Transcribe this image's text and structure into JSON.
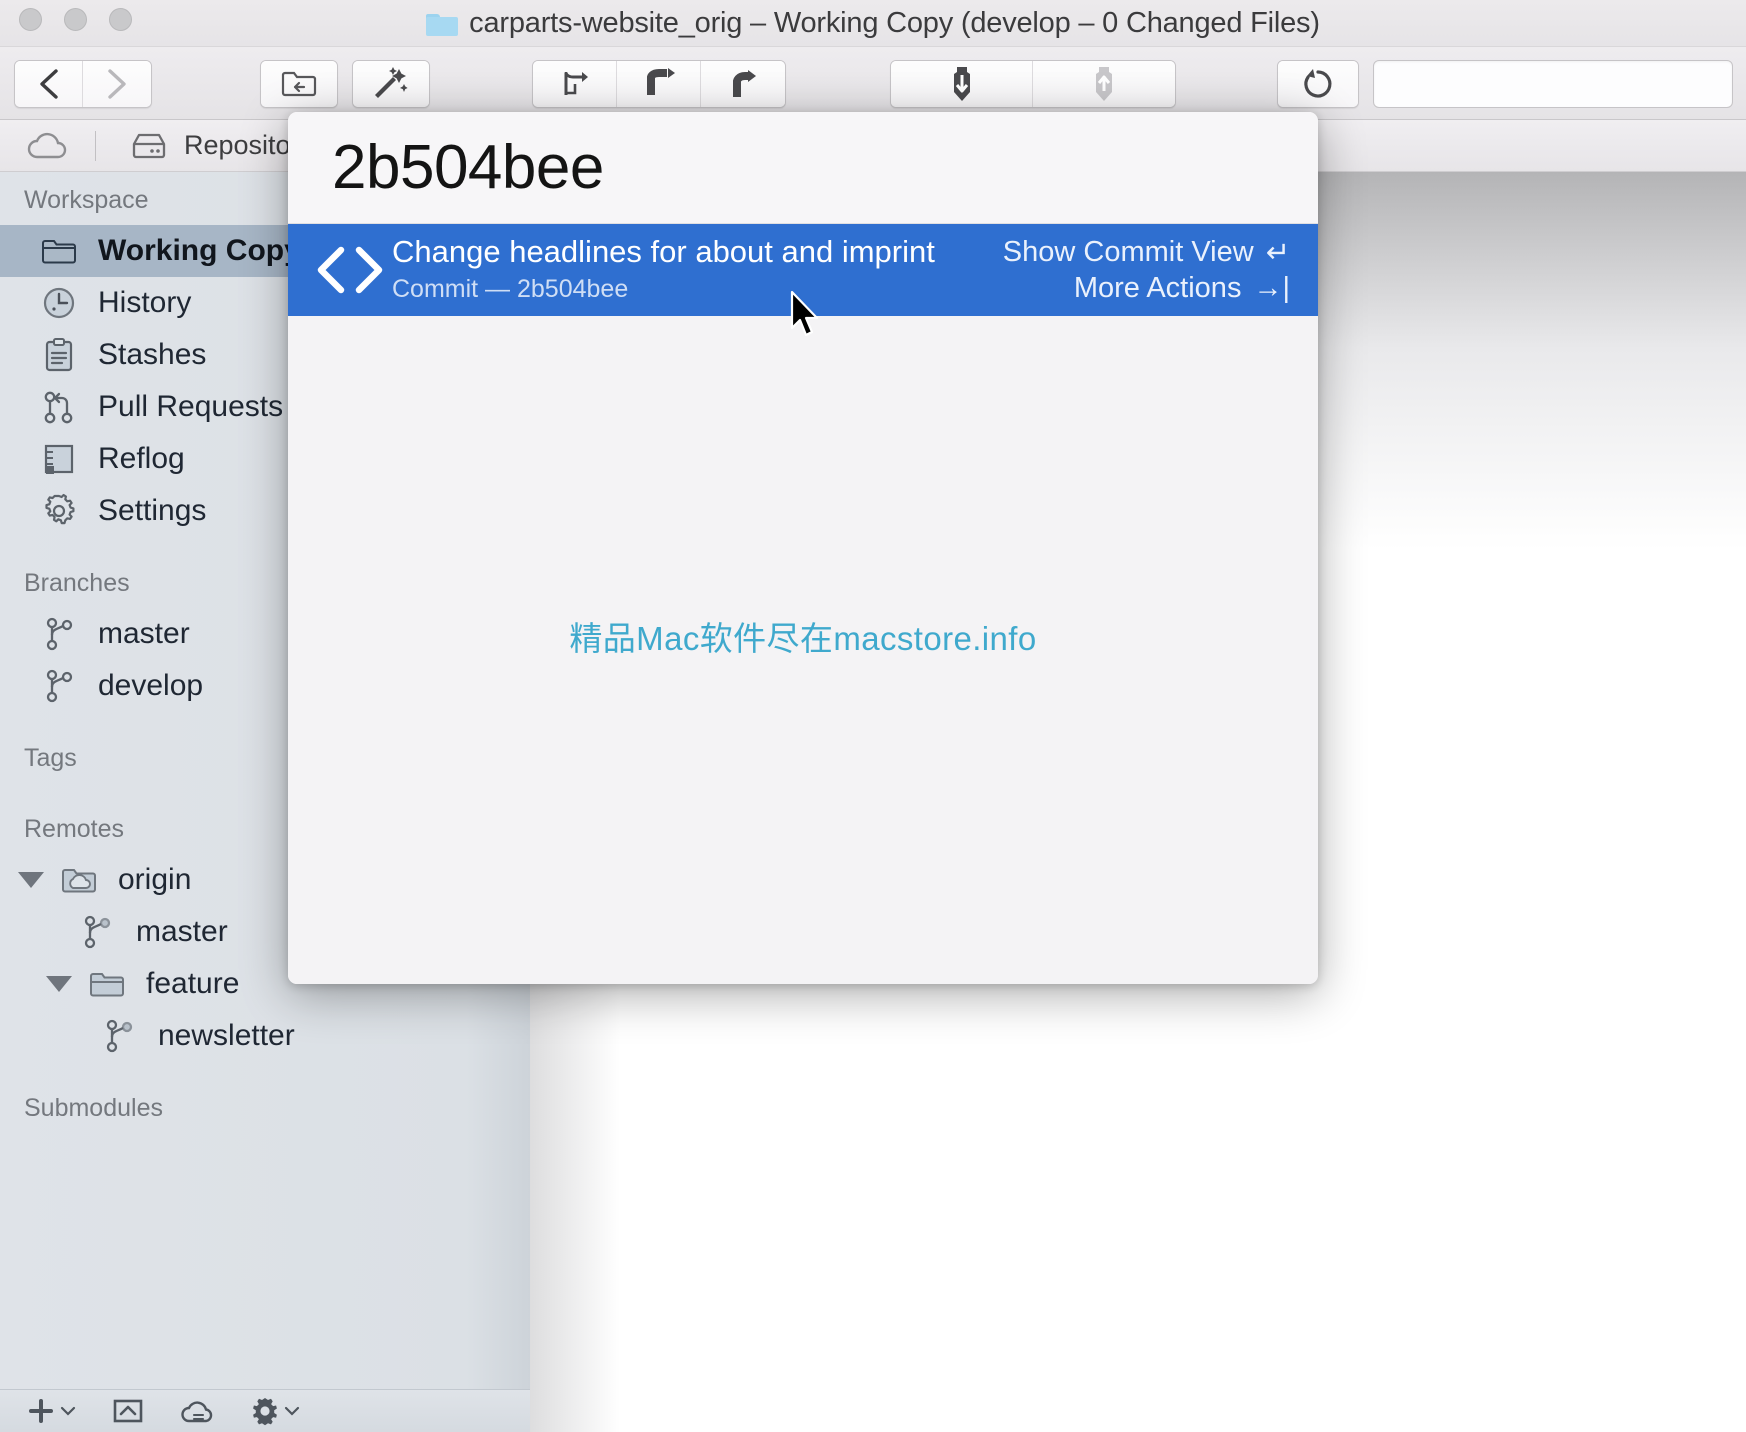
{
  "window": {
    "title": "carparts-website_orig – Working Copy (develop – 0 Changed Files)",
    "title_icon": "folder-icon"
  },
  "traffic_lights": [
    {
      "name": "close-button",
      "label": ""
    },
    {
      "name": "minimize-button",
      "label": ""
    },
    {
      "name": "zoom-button",
      "label": ""
    }
  ],
  "toolbar": {
    "groups": [
      {
        "name": "navigation",
        "buttons": [
          {
            "name": "back-button",
            "icon": "chevron-left-icon"
          },
          {
            "name": "forward-button",
            "icon": "chevron-right-icon"
          }
        ]
      },
      {
        "name": "open-repo",
        "buttons": [
          {
            "name": "open-in-finder-button",
            "icon": "folder-return-icon"
          }
        ]
      },
      {
        "name": "magic",
        "buttons": [
          {
            "name": "quick-actions-button",
            "icon": "magic-wand-icon"
          }
        ]
      },
      {
        "name": "branch-ops",
        "buttons": [
          {
            "name": "branch-button",
            "icon": "branch-arrow-icon"
          },
          {
            "name": "merge-button",
            "icon": "merge-arrow-icon"
          },
          {
            "name": "rebase-button",
            "icon": "rebase-arrow-icon"
          }
        ]
      },
      {
        "name": "sync",
        "buttons": [
          {
            "name": "pull-button",
            "icon": "pull-down-icon"
          },
          {
            "name": "push-button",
            "icon": "push-up-icon"
          }
        ]
      },
      {
        "name": "history",
        "buttons": [
          {
            "name": "discard-button",
            "icon": "revert-clock-icon"
          }
        ]
      }
    ],
    "search": {
      "name": "search-field",
      "value": "",
      "placeholder": ""
    }
  },
  "tabbar": {
    "cloud_icon": "cloud-icon",
    "repositories_label": "Repositories",
    "repositories_icon": "drive-icon"
  },
  "sidebar": {
    "sections": [
      {
        "heading": "Workspace",
        "items": [
          {
            "label": "Working Copy",
            "icon": "folder-icon",
            "name": "sidebar-item-working-copy",
            "selected": true
          },
          {
            "label": "History",
            "icon": "clock-icon",
            "name": "sidebar-item-history",
            "selected": false
          },
          {
            "label": "Stashes",
            "icon": "clipboard-icon",
            "name": "sidebar-item-stashes",
            "selected": false
          },
          {
            "label": "Pull Requests",
            "icon": "pull-request-icon",
            "name": "sidebar-item-pull-requests",
            "selected": false
          },
          {
            "label": "Reflog",
            "icon": "reflog-icon",
            "name": "sidebar-item-reflog",
            "selected": false
          },
          {
            "label": "Settings",
            "icon": "gear-icon",
            "name": "sidebar-item-settings",
            "selected": false
          }
        ]
      },
      {
        "heading": "Branches",
        "items": [
          {
            "label": "master",
            "icon": "branch-icon",
            "name": "sidebar-branch-master",
            "selected": false
          },
          {
            "label": "develop",
            "icon": "branch-icon",
            "name": "sidebar-branch-develop",
            "selected": false
          }
        ]
      },
      {
        "heading": "Tags",
        "items": []
      },
      {
        "heading": "Remotes",
        "items": [
          {
            "label": "origin",
            "icon": "remote-folder-icon",
            "name": "sidebar-remote-origin",
            "selected": false,
            "indent": 0,
            "disclosure": "expanded"
          },
          {
            "label": "master",
            "icon": "branch-icon",
            "name": "sidebar-remote-master",
            "selected": false,
            "indent": 1
          },
          {
            "label": "feature",
            "icon": "folder-icon",
            "name": "sidebar-remote-feature",
            "selected": false,
            "indent": 1,
            "disclosure": "expanded"
          },
          {
            "label": "newsletter",
            "icon": "branch-icon",
            "name": "sidebar-remote-newsletter",
            "selected": false,
            "indent": 2
          }
        ]
      },
      {
        "heading": "Submodules",
        "items": []
      }
    ],
    "footer": [
      {
        "name": "add-button",
        "icon": "plus-icon",
        "caret": true
      },
      {
        "name": "pull-icon-button",
        "icon": "tray-up-icon",
        "caret": false
      },
      {
        "name": "cloud-button",
        "icon": "cloud-lines-icon",
        "caret": false
      },
      {
        "name": "settings-button",
        "icon": "gear-icon",
        "caret": true
      }
    ]
  },
  "quick_actions": {
    "query": "2b504bee",
    "result": {
      "icon": "code-brackets-icon",
      "title": "Change headlines for about and imprint",
      "subtitle": "Commit — 2b504bee",
      "actions": [
        {
          "label": "Show Commit View",
          "key": "↵",
          "name": "show-commit-view-action"
        },
        {
          "label": "More Actions",
          "key": "→|",
          "name": "more-actions-action"
        }
      ]
    },
    "watermark": "精品Mac软件尽在macstore.info",
    "accent_color": "#2f6fd0",
    "watermark_color": "#3fa9cd"
  }
}
